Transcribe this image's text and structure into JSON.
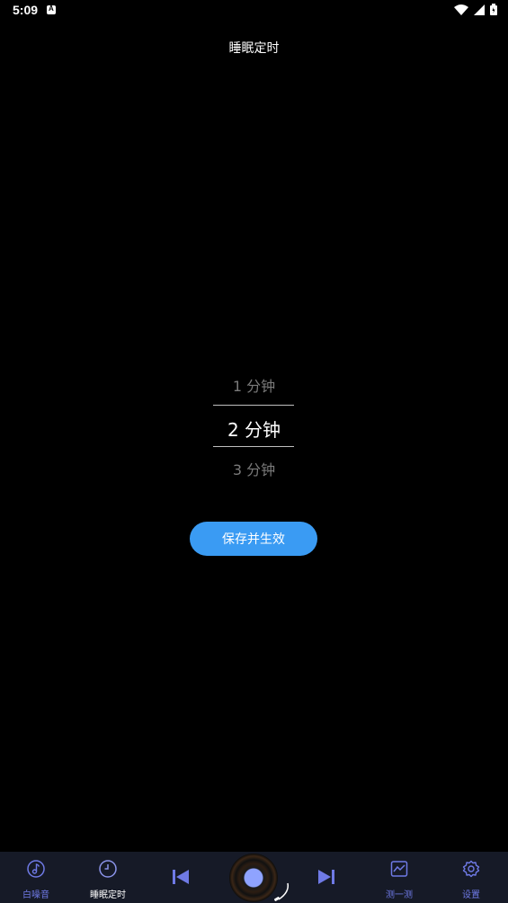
{
  "status_bar": {
    "time": "5:09",
    "notification_badge": "A",
    "icons": [
      "wifi-icon",
      "signal-icon",
      "battery-icon"
    ]
  },
  "header": {
    "title": "睡眠定时"
  },
  "picker": {
    "items": [
      "1 分钟",
      "2 分钟",
      "3 分钟"
    ],
    "selected_index": 1
  },
  "save_button": {
    "label": "保存并生效"
  },
  "bottom_nav": {
    "items": [
      {
        "label": "白噪音",
        "icon": "music-note-icon"
      },
      {
        "label": "睡眠定时",
        "icon": "clock-icon",
        "active": true
      },
      {
        "label": "测一测",
        "icon": "chart-icon"
      },
      {
        "label": "设置",
        "icon": "gear-icon"
      }
    ],
    "controls": [
      "previous-icon",
      "record-disc-icon",
      "next-icon"
    ]
  },
  "colors": {
    "background": "#000000",
    "accent_button": "#3a9bf3",
    "nav_background": "#161a27",
    "nav_icon": "#6f7ae6"
  }
}
